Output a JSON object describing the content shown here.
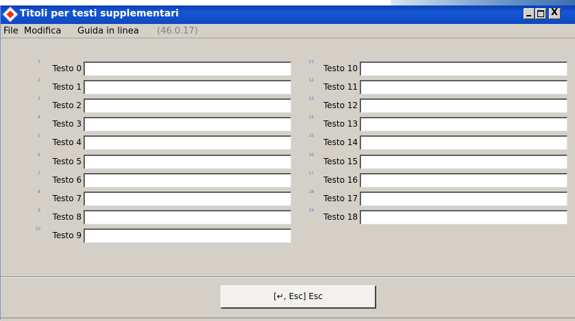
{
  "window": {
    "title": "Titoli per testi supplementari",
    "minimize": "_",
    "close": "X"
  },
  "menu": {
    "file": "File",
    "modifica": "Modifica",
    "guida": "Guida in linea",
    "version": "(46.0.17)"
  },
  "left_fields": [
    {
      "num": "1",
      "label": "Testo 0",
      "value": ""
    },
    {
      "num": "2",
      "label": "Testo 1",
      "value": ""
    },
    {
      "num": "3",
      "label": "Testo 2",
      "value": ""
    },
    {
      "num": "4",
      "label": "Testo 3",
      "value": ""
    },
    {
      "num": "5",
      "label": "Testo 4",
      "value": ""
    },
    {
      "num": "6",
      "label": "Testo 5",
      "value": ""
    },
    {
      "num": "7",
      "label": "Testo 6",
      "value": ""
    },
    {
      "num": "8",
      "label": "Testo 7",
      "value": ""
    },
    {
      "num": "9",
      "label": "Testo 8",
      "value": ""
    },
    {
      "num": "10",
      "label": "Testo 9",
      "value": ""
    }
  ],
  "right_fields": [
    {
      "num": "11",
      "label": "Testo 10",
      "value": ""
    },
    {
      "num": "12",
      "label": "Testo 11",
      "value": ""
    },
    {
      "num": "13",
      "label": "Testo 12",
      "value": ""
    },
    {
      "num": "14",
      "label": "Testo 13",
      "value": ""
    },
    {
      "num": "15",
      "label": "Testo 14",
      "value": ""
    },
    {
      "num": "16",
      "label": "Testo 15",
      "value": ""
    },
    {
      "num": "17",
      "label": "Testo 16",
      "value": ""
    },
    {
      "num": "18",
      "label": "Testo 17",
      "value": ""
    },
    {
      "num": "19",
      "label": "Testo 18",
      "value": ""
    }
  ],
  "footer": {
    "esc_button": "[↵, Esc] Esc"
  }
}
